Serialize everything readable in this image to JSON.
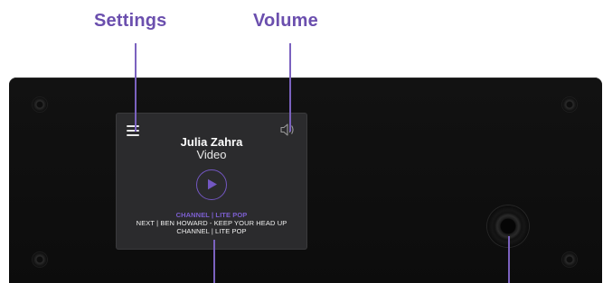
{
  "callouts": {
    "settings": "Settings",
    "volume": "Volume"
  },
  "screen": {
    "artist": "Julia Zahra",
    "subtitle": "Video",
    "channel_highlight": "CHANNEL | LITE POP",
    "next": "NEXT | BEN HOWARD - KEEP YOUR HEAD UP",
    "channel": "CHANNEL | LITE POP"
  },
  "icons": {
    "menu": "hamburger-menu-icon",
    "volume": "speaker-icon",
    "play": "play-icon"
  },
  "colors": {
    "accent": "#6b4fae",
    "highlight": "#7c5fd0",
    "device": "#111111",
    "screen": "#2b2b2d"
  }
}
